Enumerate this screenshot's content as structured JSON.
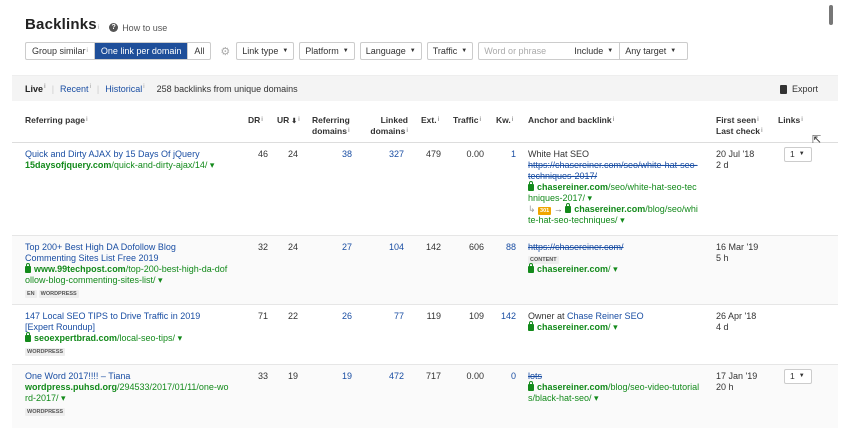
{
  "header": {
    "title": "Backlinks",
    "title_sup": "i",
    "howto": "How to use"
  },
  "filters": {
    "group_similar": "Group similar",
    "one_link": "One link per domain",
    "all": "All",
    "link_type": "Link type",
    "platform": "Platform",
    "language": "Language",
    "traffic": "Traffic",
    "search_placeholder": "Word or phrase",
    "include": "Include",
    "any_target": "Any target"
  },
  "tabs": {
    "live": "Live",
    "recent": "Recent",
    "historical": "Historical",
    "count_text": "258 backlinks from unique domains",
    "export": "Export"
  },
  "columns": {
    "referring_page": "Referring page",
    "dr": "DR",
    "ur": "UR",
    "referring_domains_1": "Referring",
    "referring_domains_2": "domains",
    "linked_domains_1": "Linked",
    "linked_domains_2": "domains",
    "ext": "Ext.",
    "traffic": "Traffic",
    "kw": "Kw.",
    "anchor": "Anchor and backlink",
    "first_seen": "First seen",
    "last_check": "Last check",
    "links": "Links"
  },
  "rows": [
    {
      "title_1": "Quick and Dirty AJAX by 15 Days Of jQuery",
      "domain": "15daysofjquery.com",
      "path": "/quick-and-dirty-ajax/14/",
      "dr": "46",
      "ur": "24",
      "ref_domains": "38",
      "linked_domains": "327",
      "ext": "479",
      "traffic": "0.00",
      "kw": "1",
      "anchor_text": "White Hat SEO",
      "anchor_old_1": "https://chasereiner.com/seo/white-hat-seo-",
      "anchor_old_2": "techniques-2017/",
      "backlink_domain": "chasereiner.com",
      "backlink_path_1": "/seo/white-hat-seo-tec",
      "backlink_path_2": "hniques-2017/",
      "redirect_code": "301",
      "redirect_domain": "chasereiner.com",
      "redirect_path_1": "/blog/seo/whi",
      "redirect_path_2": "te-hat-seo-techniques/",
      "first_seen": "20 Jul '18",
      "last_check": "2 d",
      "links": "1"
    },
    {
      "title_1": "Top 200+ Best High DA Dofollow Blog",
      "title_2": "Commenting Sites List Free 2019",
      "domain": "www.99techpost.com",
      "path_1": "/top-200-best-high-da-dof",
      "path_2": "ollow-blog-commenting-sites-list/",
      "tag_1": "EN",
      "tag_2": "WORDPRESS",
      "dr": "32",
      "ur": "24",
      "ref_domains": "27",
      "linked_domains": "104",
      "ext": "142",
      "traffic": "606",
      "kw": "88",
      "anchor_old": "https://chasereiner.com/",
      "anchor_tag": "CONTENT",
      "backlink_domain": "chasereiner.com",
      "backlink_path": "/",
      "first_seen": "16 Mar '19",
      "last_check": "5 h"
    },
    {
      "title_1": "147 Local SEO TIPS to Drive Traffic in 2019",
      "title_2": "[Expert Roundup]",
      "domain": "seoexpertbrad.com",
      "path": "/local-seo-tips/",
      "tag_1": "WORDPRESS",
      "dr": "71",
      "ur": "22",
      "ref_domains": "26",
      "linked_domains": "77",
      "ext": "119",
      "traffic": "109",
      "kw": "142",
      "anchor_prefix": "Owner at",
      "anchor_link": "Chase Reiner SEO",
      "backlink_domain": "chasereiner.com",
      "backlink_path": "/",
      "first_seen": "26 Apr '18",
      "last_check": "4 d"
    },
    {
      "title_1": "One Word 2017!!!! – Tiana",
      "domain": "wordpress.puhsd.org",
      "path_1": "/294533/2017/01/11/one-wo",
      "path_2": "rd-2017/",
      "tag_1": "WORDPRESS",
      "dr": "33",
      "ur": "19",
      "ref_domains": "19",
      "linked_domains": "472",
      "ext": "717",
      "traffic": "0.00",
      "kw": "0",
      "anchor_old": "lots",
      "backlink_domain": "chasereiner.com",
      "backlink_path_1": "/blog/seo-video-tutorial",
      "backlink_path_2": "s/black-hat-seo/",
      "first_seen": "17 Jan '19",
      "last_check": "20 h",
      "links": "1"
    }
  ],
  "colors": {
    "accent": "#1f4f9a",
    "link": "#1a4ea3",
    "green": "#138a1b"
  }
}
